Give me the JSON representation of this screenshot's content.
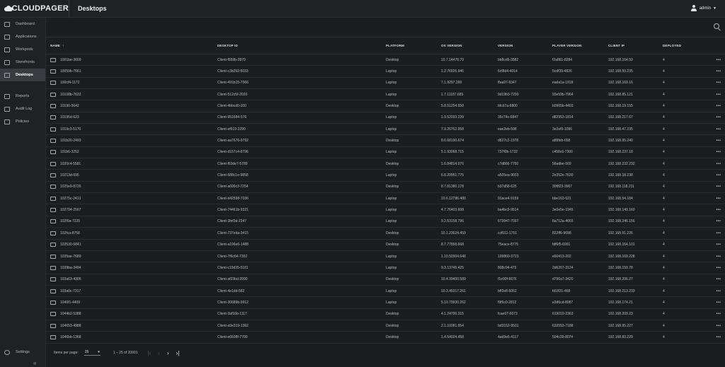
{
  "header": {
    "brand": "CLOUDPAGER",
    "title": "Desktops",
    "user": "admin"
  },
  "sidebar": {
    "items": [
      {
        "label": "Dashboard",
        "icon": "dashboard-icon"
      },
      {
        "label": "Applications",
        "icon": "applications-icon"
      },
      {
        "label": "Workpods",
        "icon": "workpods-icon"
      },
      {
        "label": "Storefronts",
        "icon": "storefronts-icon"
      },
      {
        "label": "Desktops",
        "icon": "desktop-icon",
        "active": true
      }
    ],
    "items2": [
      {
        "label": "Reports",
        "icon": "reports-icon"
      },
      {
        "label": "Audit Log",
        "icon": "audit-log-icon"
      },
      {
        "label": "Policies",
        "icon": "policies-icon"
      }
    ],
    "settings": "Settings",
    "collapse": "«"
  },
  "table": {
    "columns": [
      "NAME",
      "DESKTOP ID",
      "PLATFORM",
      "OS VERSION",
      "VERSION",
      "PLAYER VERSION",
      "CLIENT IP",
      "DEPLOYED"
    ],
    "sort_arrow": "↑",
    "menu_glyph": "•••",
    "rows": [
      [
        "1001be-3609",
        "Client-f659b-2870",
        "Desktop",
        "10.7.14478.70",
        "bb8cd6-3582",
        "f2a881-8284",
        "192.168.164.50",
        "4"
      ],
      [
        "10059b-7661",
        "Client-c3b292-5033",
        "Laptop",
        "1.2.76926.946",
        "6cf8d4-4014",
        "5cdf39-4826",
        "192.168.50.235",
        "4"
      ],
      [
        "100cf4-1172",
        "Client-491b15-7066",
        "Laptop",
        "7.1.9297.299",
        "ffaa97-9347",
        "eada1a-1918",
        "192.168.169.16",
        "4"
      ],
      [
        "10108b-7632",
        "Client-512c5f-2020",
        "Laptop",
        "1.7.11187.685",
        "9d19b3-7290",
        "93e59b-7964",
        "192.168.85.121",
        "4"
      ],
      [
        "10190-5642",
        "Client-4bbcd0-100",
        "Desktop",
        "5.8.51254.550",
        "bfcd7a-6800",
        "b0965b-4403",
        "192.168.19.155",
        "4"
      ],
      [
        "10195d-623",
        "Client-951684-576",
        "Laptop",
        "1.9.52033.239",
        "35c74c-6847",
        "d82953-1814",
        "192.168.217.67",
        "4"
      ],
      [
        "1019c3-5176",
        "Client-ef619-2290",
        "Laptop",
        "7.9.26762.958",
        "eae2eb-598",
        "3e2ef9-1096",
        "192.168.47.235",
        "4"
      ],
      [
        "101b20-2493",
        "Client-aa7676-9792",
        "Desktop",
        "8.6.68190.674",
        "d827c2-1978",
        "a89feb-658",
        "192.168.95.240",
        "4"
      ],
      [
        "101b6-3252",
        "Client-d157c4-8796",
        "Laptop",
        "5.1.93068.715",
        "737f0b-1732",
        "c458c6-7300",
        "192.168.237.18",
        "4"
      ],
      [
        "1020c4-5581",
        "Client-f63de7-5789",
        "Desktop",
        "1.6.84814.976",
        "c7d866-7750",
        "58adbe-569",
        "192.168.232.232",
        "4"
      ],
      [
        "10213d-695",
        "Client-688c1e-9858",
        "Laptop",
        "6.8.20951.775",
        "a505ea-9033",
        "2e352e-7630",
        "192.168.18.238",
        "4"
      ],
      [
        "1025e9-8726",
        "Client-a699c3-7254",
        "Desktop",
        "8.7.81380.178",
        "b37d58-625",
        "30f823-3967",
        "192.168.118.211",
        "4"
      ],
      [
        "10275c-2413",
        "Client-d42598-7036",
        "Laptop",
        "10.6.12786.489",
        "91ace4-9159",
        "bbe163-621",
        "192.168.54.184",
        "4"
      ],
      [
        "102794-2567",
        "Client-74461b-9321",
        "Laptop",
        "4.7.76403.608",
        "ba4bc0-9514",
        "3e0e5e-1945",
        "192.168.140.160",
        "4"
      ],
      [
        "102f0a-7225",
        "Client-3fef3d-2347",
        "Laptop",
        "9.2.53158.796",
        "673947-7097",
        "8a712a-4003",
        "192.168.246.156",
        "4"
      ],
      [
        "102fca-8758",
        "Client-737eda-3415",
        "Desktop",
        "10.1.23624.459",
        "ccf011-1751",
        "822ff6-9698",
        "192.168.91.226",
        "4"
      ],
      [
        "103530-6841",
        "Client-a196e6-1488",
        "Desktop",
        "8.7.77858.668",
        "75eace-8775",
        "fdf6f5-6991",
        "192.168.164.101",
        "4"
      ],
      [
        "1035ae-7689",
        "Client-7f6c64-7302",
        "Laptop",
        "1.10.50304.648",
        "199860-3723",
        "e60413-202",
        "192.168.169.228",
        "4"
      ],
      [
        "1039ba-3494",
        "Client-c19d35-5181",
        "Laptop",
        "9.3.13745.425",
        "808c94-473",
        "2d6267-3124",
        "192.168.150.78",
        "4"
      ],
      [
        "103a63-4396",
        "Client-af23bd-3990",
        "Desktop",
        "10.4.39400.589",
        "f1e90f-6676",
        "d796a7-3420",
        "192.168.206.27",
        "4"
      ],
      [
        "103a0c-7317",
        "Client-4e1dd-582",
        "Laptop",
        "10.3.45317.261",
        "bff2e8-5052",
        "fd1831-468",
        "192.168.213.233",
        "4"
      ],
      [
        "1040f1-4409",
        "Client-30689b-9912",
        "Laptop",
        "5.10.79930.262",
        "f9f6c0-2812",
        "e3d6cd-8087",
        "192.168.174.21",
        "4"
      ],
      [
        "1044b2-5388",
        "Client-3af16b-1117",
        "Desktop",
        "4.1.24790.315",
        "fcae07-6073",
        "619019-2363",
        "192.168.209.23",
        "4"
      ],
      [
        "104653-4988",
        "Client-a9e319-1362",
        "Desktop",
        "2.1.10081.954",
        "bd3152-9531",
        "633553-7188",
        "192.168.95.227",
        "4"
      ],
      [
        "1046bb-1368",
        "Client-e6608f-7700",
        "Desktop",
        "1.4.54024.458",
        "4ad9e6-4117",
        "504c39-8074",
        "192.168.83.229",
        "4"
      ]
    ]
  },
  "pager": {
    "label": "Items per page:",
    "per_page": "25",
    "range": "1 – 25 of 20001",
    "first": "|‹",
    "prev": "‹",
    "next": "›",
    "last": "›|"
  }
}
